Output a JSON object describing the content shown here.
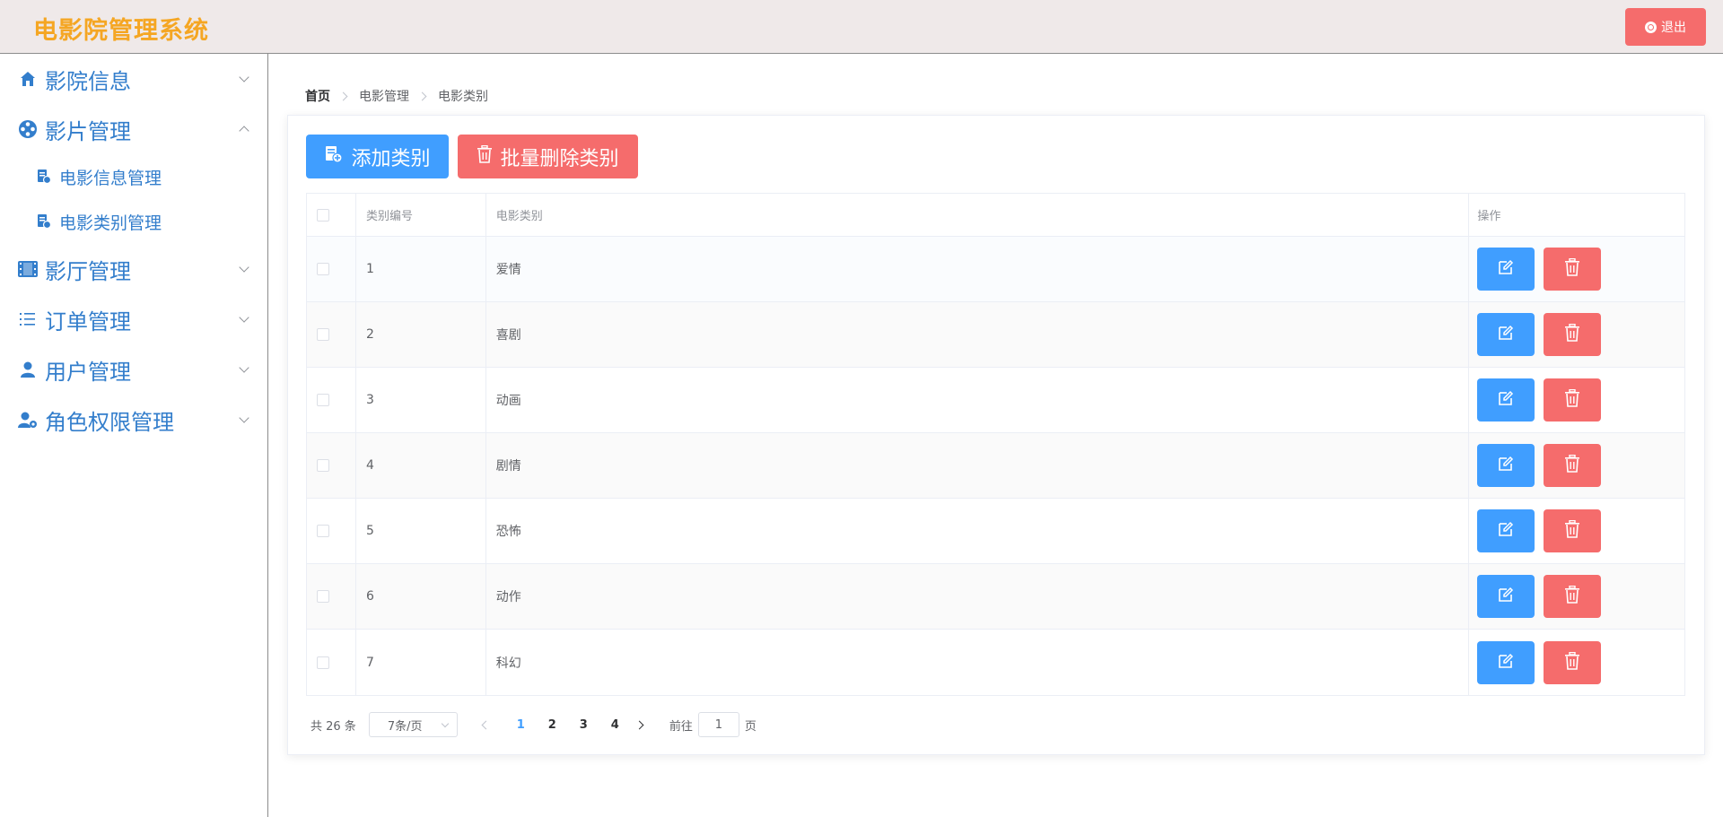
{
  "header": {
    "app_title": "电影院管理系统",
    "logout_label": "退出"
  },
  "sidebar": {
    "items": [
      {
        "label": "影院信息",
        "icon": "home-icon",
        "expanded": false
      },
      {
        "label": "影片管理",
        "icon": "film-reel-icon",
        "expanded": true,
        "children": [
          {
            "label": "电影信息管理",
            "icon": "document-icon"
          },
          {
            "label": "电影类别管理",
            "icon": "document-icon"
          }
        ]
      },
      {
        "label": "影厅管理",
        "icon": "film-strip-icon",
        "expanded": false
      },
      {
        "label": "订单管理",
        "icon": "list-icon",
        "expanded": false
      },
      {
        "label": "用户管理",
        "icon": "user-icon",
        "expanded": false
      },
      {
        "label": "角色权限管理",
        "icon": "user-settings-icon",
        "expanded": false
      }
    ]
  },
  "breadcrumb": [
    "首页",
    "电影管理",
    "电影类别"
  ],
  "toolbar": {
    "add_label": "添加类别",
    "batch_delete_label": "批量删除类别"
  },
  "table": {
    "columns": [
      "类别编号",
      "电影类别",
      "操作"
    ],
    "rows": [
      {
        "id": "1",
        "name": "爱情"
      },
      {
        "id": "2",
        "name": "喜剧"
      },
      {
        "id": "3",
        "name": "动画"
      },
      {
        "id": "4",
        "name": "剧情"
      },
      {
        "id": "5",
        "name": "恐怖"
      },
      {
        "id": "6",
        "name": "动作"
      },
      {
        "id": "7",
        "name": "科幻"
      }
    ]
  },
  "pagination": {
    "total_label": "共 26 条",
    "page_size_label": "7条/页",
    "pages": [
      "1",
      "2",
      "3",
      "4"
    ],
    "current_page": "1",
    "goto_prefix": "前往",
    "goto_value": "1",
    "goto_suffix": "页"
  },
  "colors": {
    "primary": "#409eff",
    "danger": "#f56c6c",
    "title": "#f5a623",
    "menu": "#337ecc"
  }
}
